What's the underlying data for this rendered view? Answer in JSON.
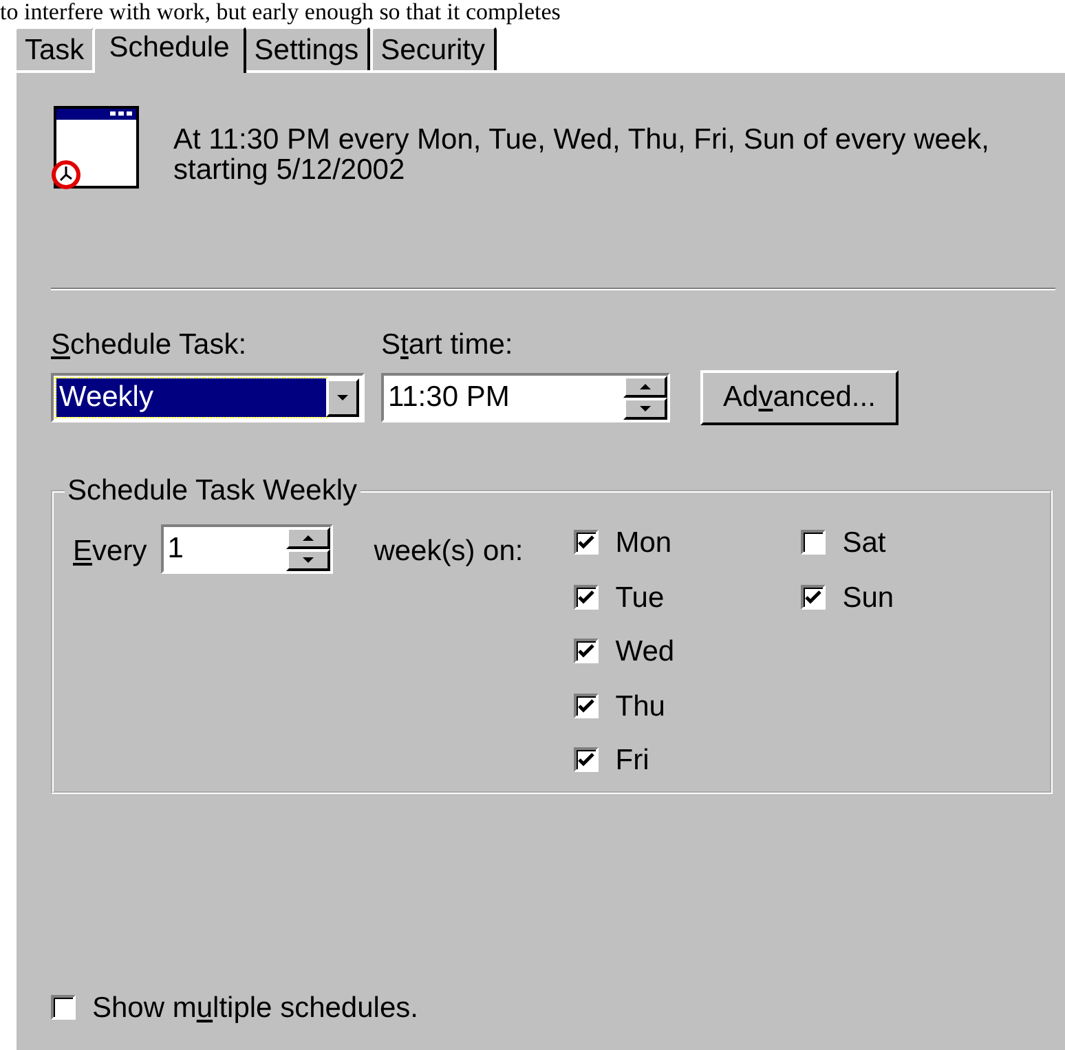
{
  "top_text": "to interfere with work, but early enough so that it completes",
  "tabs": [
    {
      "label": "Task",
      "selected": false
    },
    {
      "label": "Schedule",
      "selected": true
    },
    {
      "label": "Settings",
      "selected": false
    },
    {
      "label": "Security",
      "selected": false
    }
  ],
  "summary": "At 11:30 PM every Mon, Tue, Wed, Thu, Fri, Sun of every week, starting 5/12/2002",
  "schedule_task": {
    "label": {
      "key": "S",
      "after": "chedule Task:"
    },
    "value": "Weekly"
  },
  "start_time": {
    "label": {
      "before": "S",
      "key": "t",
      "after": "art time:"
    },
    "value": "11:30 PM"
  },
  "advanced_button": {
    "label": {
      "before": "Ad",
      "key": "v",
      "after": "anced..."
    }
  },
  "group": {
    "title": "Schedule Task Weekly",
    "every": {
      "label": {
        "key": "E",
        "after": "very"
      },
      "value": "1"
    },
    "weeks_label": "week(s) on:",
    "days": [
      {
        "label": "Mon",
        "checked": true
      },
      {
        "label": "Tue",
        "checked": true
      },
      {
        "label": "Wed",
        "checked": true
      },
      {
        "label": "Thu",
        "checked": true
      },
      {
        "label": "Fri",
        "checked": true
      },
      {
        "label": "Sat",
        "checked": false
      },
      {
        "label": "Sun",
        "checked": true
      }
    ]
  },
  "show_multiple": {
    "label": {
      "before": "Show m",
      "key": "u",
      "after": "ltiple schedules."
    },
    "checked": false
  }
}
